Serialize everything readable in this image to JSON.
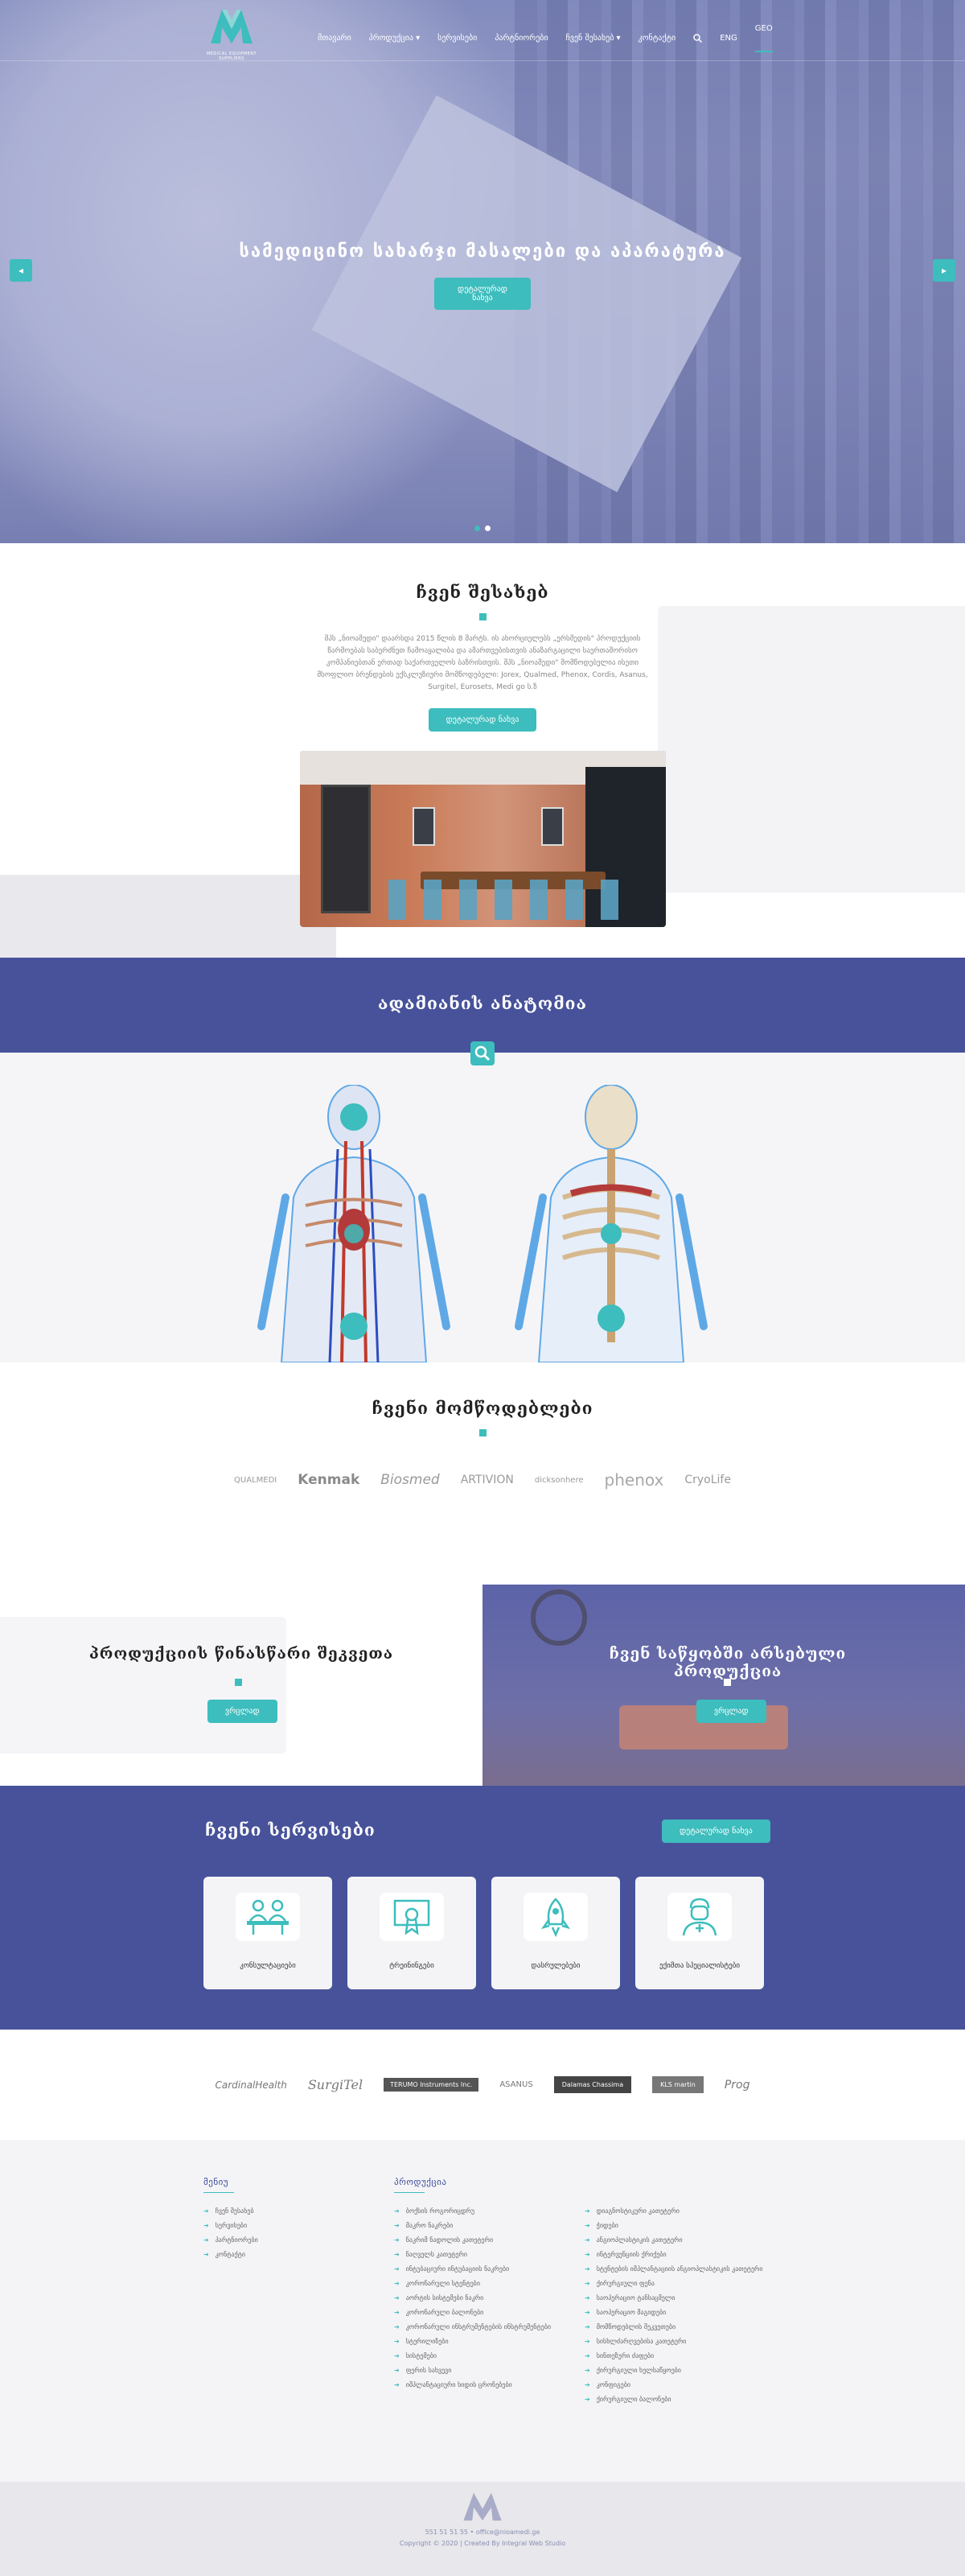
{
  "nav": {
    "logo_text": "MEDICAL EQUIPMENT SUPPLIERS",
    "items": [
      {
        "label": "მთავარი",
        "caret": false
      },
      {
        "label": "პროდუქცია",
        "caret": true
      },
      {
        "label": "სერვისები",
        "caret": false
      },
      {
        "label": "პარტნიორები",
        "caret": false
      },
      {
        "label": "ჩვენ შესახებ",
        "caret": true
      },
      {
        "label": "კონტაქტი",
        "caret": false
      },
      {
        "label": "ENG",
        "caret": false
      },
      {
        "label": "GEO",
        "caret": false
      }
    ],
    "search_icon": "search-icon"
  },
  "hero": {
    "title": "სამედიცინო სახარჯი მასალები და აპარატურა",
    "button": "დეტალურად ნახვა",
    "prev": "◂",
    "next": "▸"
  },
  "about": {
    "title": "ჩვენ შესახებ",
    "text": "შპს „ნიოამედი\" დაარსდა 2015 წლის 8 მარტს. ის ახორციელებს „ერსმედის\" პროდუქციის წარმოებას საბერძნეთ ჩამოაყალიბა და ამართვებისთვის ანაზარგაცილი საერთაშორისო კომპანიებთან ერთად საქართველოს ბაზრისთვის. შპს „ნიოამედი\" მომწოდებელია ისეთი მსოფლიო ბრენდების ექსკლუზიური მომწოდებელი: Jorex, Qualmed, Phenox, Cordis, Asanus, Surgitel, Eurosets, Medi go ს.ზ",
    "button": "დეტალურად ნახვა"
  },
  "anatomy": {
    "title": "ადამიანის ანატომია"
  },
  "suppliers": {
    "title": "ჩვენი მომწოდებლები",
    "brands": [
      "QUALMEDI",
      "Kenmak",
      "Biosmed",
      "ARTIVION",
      "dicksonhere",
      "phenox",
      "CryoLife"
    ]
  },
  "split": {
    "left_title": "პროდუქციის წინასწარი შეკვეთა",
    "left_button": "ვრცლად",
    "right_title": "ჩვენ საწყობში არსებული პროდუქცია",
    "right_button": "ვრცლად"
  },
  "services": {
    "title": "ჩვენი სერვისები",
    "button": "დეტალურად ნახვა",
    "cards": [
      {
        "label": "კონსულტაციები",
        "icon": "consultation-icon"
      },
      {
        "label": "ტრეინინგები",
        "icon": "certificate-icon"
      },
      {
        "label": "დასრულებები",
        "icon": "rocket-icon"
      },
      {
        "label": "ექიმთა სპეციალისტები",
        "icon": "doctor-icon"
      }
    ]
  },
  "partners": [
    "CardinalHealth",
    "SurgiTel",
    "TERUMO Instruments Inc.",
    "ASANUS",
    "Dalamas Chassima",
    "KLS martin",
    "Prog"
  ],
  "footer": {
    "menu_title": "მენიუ",
    "menu_items": [
      "ჩვენ შესახებ",
      "სერვისები",
      "პარტნიორები",
      "კონტაქტი"
    ],
    "products_title": "პროდუქცია",
    "col1": [
      "ბოქსის როგორიცდრუ",
      "მაკრო ნაკრები",
      "ნაკრიმ ნადოლის კათეტერი",
      "ნაღველს კათეტერი",
      "ინტუბაციური ინტუბაციის ნაკრები",
      "კორონარული სტენტები",
      "აორტის სისტემები ნაკრი",
      "კორონარული ბალონები",
      "კორონარული ინსტრუმენტების ინსტრუმენტები",
      "სტერილიზები",
      "სისტემები",
      "ფერის სახვევი",
      "იმპლანტაციური ხიდის ცრონებები"
    ],
    "col2": [
      "დიაგნოსტიკური კათეტერი",
      "ჭიდები",
      "ანგიოპლასტიკის კათეტერი",
      "ინტერვენციის ქრიქები",
      "სტენტების იმპლანტაციის ანგიოპლასტიკის კათეტერი",
      "ქირურგიული ფენა",
      "საოპერაციო ტანსაცმელი",
      "საოპერაციო მაგიდები",
      "მომწოდებლის შეკვეთები",
      "სისხლძარღვებისა კათეტერი",
      "სინთეზური ძაფები",
      "ქირურგიული ხელსაწყოები",
      "კონფიგები",
      "ქირურგიული ბალონები"
    ]
  },
  "bottom": {
    "contact": "551 51 51 55 • office@nioamedi.ge",
    "copyright": "Copyright © 2020 | Created By Integral Web Studio"
  },
  "colors": {
    "teal": "#3dbdbd",
    "indigo": "#47529a"
  }
}
